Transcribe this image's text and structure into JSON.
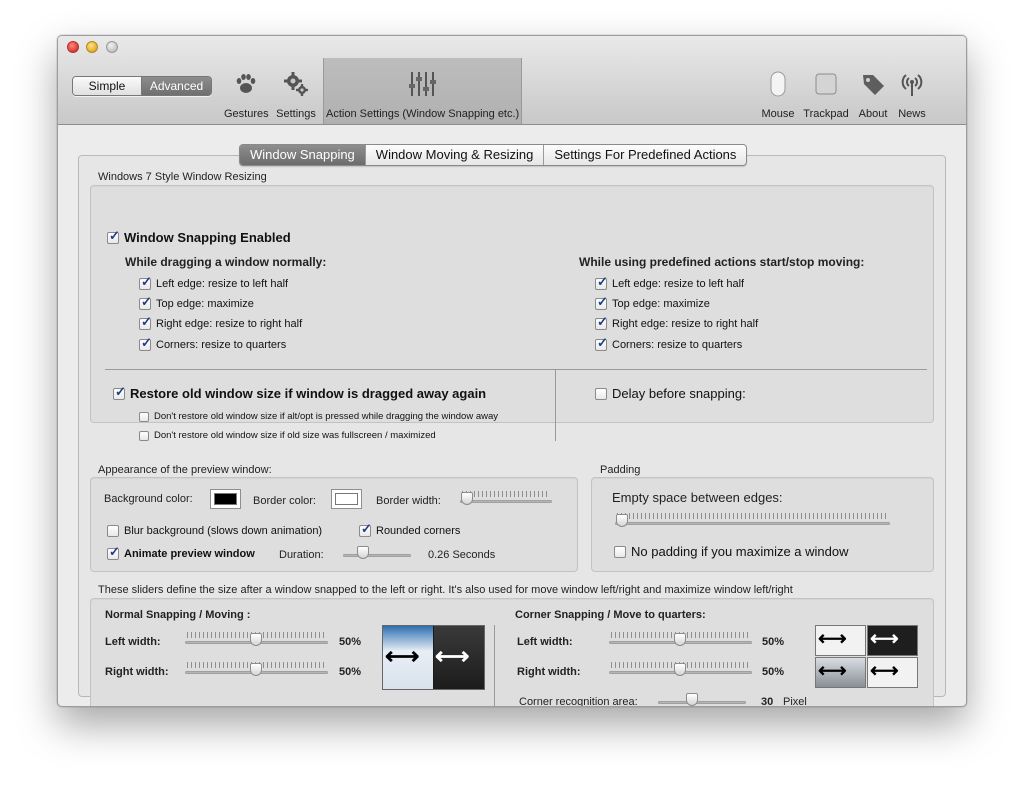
{
  "toolbar": {
    "mode_simple": "Simple",
    "mode_advanced": "Advanced",
    "items_left": [
      {
        "label": "Gestures",
        "icon": "paw-icon"
      },
      {
        "label": "Settings",
        "icon": "gears-icon"
      },
      {
        "label": "Action Settings (Window Snapping etc.)",
        "icon": "sliders-icon"
      }
    ],
    "items_right": [
      {
        "label": "Mouse",
        "icon": "mouse-icon"
      },
      {
        "label": "Trackpad",
        "icon": "trackpad-icon"
      },
      {
        "label": "About",
        "icon": "tag-icon"
      },
      {
        "label": "News",
        "icon": "antenna-icon"
      }
    ]
  },
  "tabs": [
    "Window Snapping",
    "Window Moving & Resizing",
    "Settings For Predefined Actions"
  ],
  "resizing": {
    "section_title": "Windows 7 Style Window Resizing",
    "enabled_label": "Window Snapping Enabled",
    "left_heading": "While dragging a window normally:",
    "right_heading": "While using predefined actions start/stop moving:",
    "options": [
      "Left edge: resize to left half",
      "Top edge: maximize",
      "Right edge: resize to right half",
      "Corners: resize to quarters"
    ],
    "restore_label": "Restore old window size if window is dragged away again",
    "restore_sub1": "Don't restore old window size if alt/opt is pressed while dragging the window away",
    "restore_sub2": "Don't restore old window size if old size was fullscreen / maximized",
    "delay_label": "Delay before snapping:"
  },
  "appearance": {
    "section_title": "Appearance of the preview window:",
    "bg_color_label": "Background color:",
    "border_color_label": "Border color:",
    "border_width_label": "Border width:",
    "blur_label": "Blur background (slows down animation)",
    "rounded_label": "Rounded corners",
    "animate_label": "Animate preview window",
    "duration_label": "Duration:",
    "duration_value": "0.26 Seconds",
    "bg_color": "#000000",
    "border_color": "#ffffff"
  },
  "padding": {
    "section_title": "Padding",
    "space_label": "Empty space between edges:",
    "no_padding_label": "No padding if you maximize a window"
  },
  "sizes": {
    "description": "These sliders define the size after a window snapped to the left or right. It's also used for move window left/right and maximize window left/right",
    "normal_title": "Normal Snapping / Moving :",
    "corner_title": "Corner Snapping / Move to quarters:",
    "left_width_label": "Left width:",
    "right_width_label": "Right width:",
    "left_value": "50%",
    "right_value": "50%",
    "corner_left_value": "50%",
    "corner_right_value": "50%",
    "corner_area_label": "Corner recognition area:",
    "corner_area_value": "30",
    "corner_area_unit": "Pixel"
  }
}
